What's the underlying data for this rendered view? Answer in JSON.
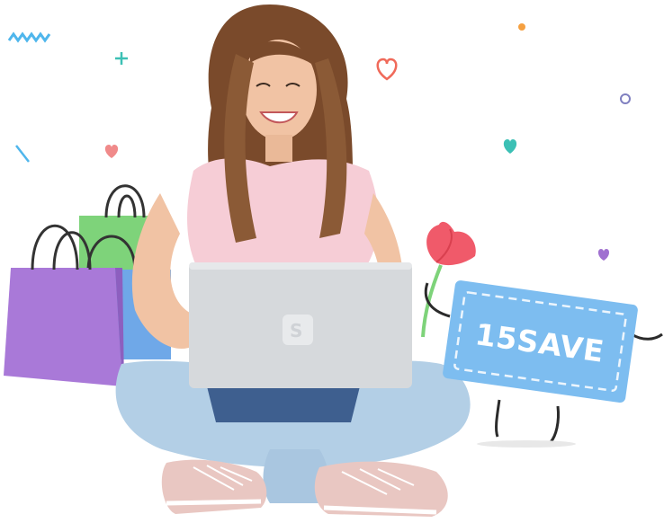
{
  "scene": {
    "description_alt": "",
    "coupon": {
      "code": "15SAVE",
      "color": "#7dbdf0",
      "border_color": "#ffffff"
    },
    "laptop": {
      "logo_letter": "S",
      "color": "#d6d9dc"
    },
    "bags": [
      {
        "name": "purple-bag",
        "color": "#a979d8"
      },
      {
        "name": "green-bag",
        "color": "#7ed37a"
      },
      {
        "name": "blue-bag",
        "color": "#6fa8e8"
      }
    ],
    "flower_color": "#f05a6a",
    "confetti": [
      {
        "icon": "zigzag",
        "color": "#4fb6ec"
      },
      {
        "icon": "plus",
        "color": "#3cc0b5"
      },
      {
        "icon": "heart",
        "color": "#f06a5a"
      },
      {
        "icon": "heart",
        "color": "#f08a8a"
      },
      {
        "icon": "heart",
        "color": "#3cc0b5"
      },
      {
        "icon": "heart",
        "color": "#a070d0"
      },
      {
        "icon": "dot",
        "color": "#f5a040"
      },
      {
        "icon": "ring",
        "color": "#8080c0"
      },
      {
        "icon": "slash",
        "color": "#4fb6ec"
      }
    ]
  }
}
